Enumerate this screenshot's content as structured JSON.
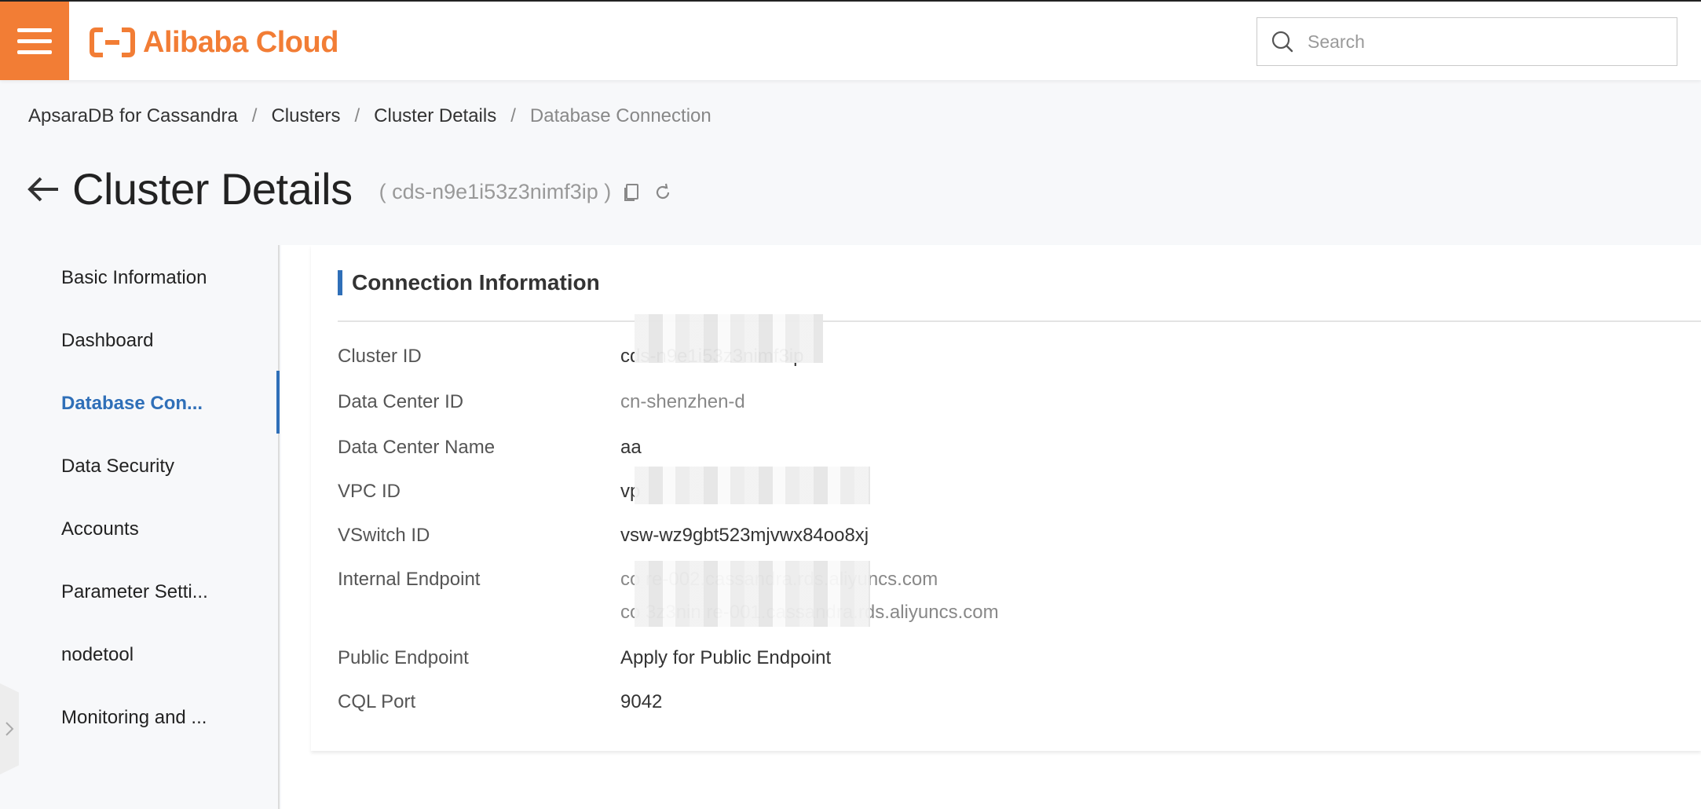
{
  "header": {
    "brand": "Alibaba Cloud",
    "search_placeholder": "Search",
    "brand_color": "#f27d35"
  },
  "breadcrumb": [
    "ApsaraDB for Cassandra",
    "Clusters",
    "Cluster Details",
    "Database Connection"
  ],
  "page": {
    "title": "Cluster Details",
    "cluster_id_display": "( cds-n9e1i53z3nimf3ip )"
  },
  "sidebar": {
    "items": [
      {
        "label": "Basic Information",
        "active": false
      },
      {
        "label": "Dashboard",
        "active": false
      },
      {
        "label": "Database Con...",
        "active": true
      },
      {
        "label": "Data Security",
        "active": false
      },
      {
        "label": "Accounts",
        "active": false
      },
      {
        "label": "Parameter Setti...",
        "active": false
      },
      {
        "label": "nodetool",
        "active": false
      },
      {
        "label": "Monitoring and ...",
        "active": false
      }
    ],
    "accent_color": "#2f6fb8"
  },
  "connection": {
    "title": "Connection Information",
    "rows": [
      {
        "label": "Cluster ID",
        "value": "cds-n9e1i53z3nimf3ip"
      },
      {
        "label": "Data Center ID",
        "value": "cn-shenzhen-d"
      },
      {
        "label": "Data Center Name",
        "value": "aa"
      },
      {
        "label": "VPC ID",
        "value": "vp"
      },
      {
        "label": "VSwitch ID",
        "value": "vsw-wz9gbt523mjvwx84oo8xj"
      },
      {
        "label": "Internal Endpoint",
        "value": "co                                  re-002.cassandra.rds.aliyuncs.com",
        "value2": "co            3z3nin                re-001.cassandra.rds.aliyuncs.com"
      },
      {
        "label": "Public Endpoint",
        "value": "Apply for Public Endpoint"
      },
      {
        "label": "CQL Port",
        "value": "9042"
      }
    ]
  }
}
